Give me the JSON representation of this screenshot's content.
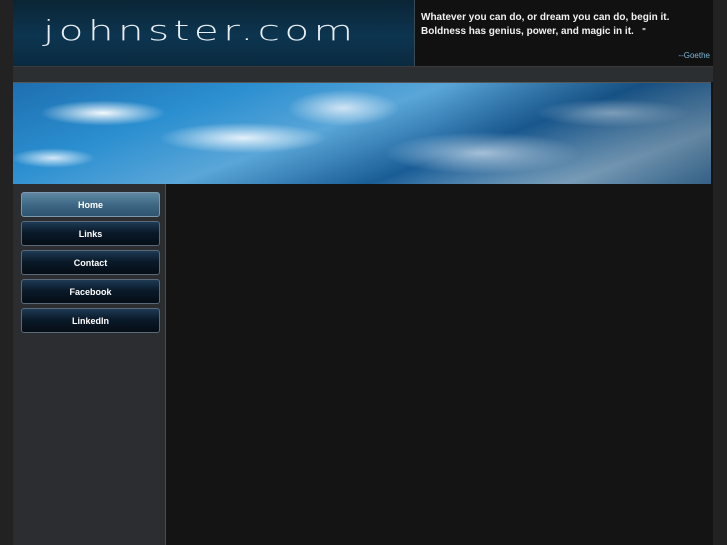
{
  "site": {
    "logo_text": "johnster.com"
  },
  "quote": {
    "text": "Whatever you can do, or dream you can do, begin it. Boldness has genius, power, and magic in it.",
    "mark": "\"",
    "author": "--Goethe"
  },
  "nav": {
    "items": [
      {
        "label": "Home",
        "active": true
      },
      {
        "label": "Links",
        "active": false
      },
      {
        "label": "Contact",
        "active": false
      },
      {
        "label": "Facebook",
        "active": false
      },
      {
        "label": "LinkedIn",
        "active": false
      }
    ]
  },
  "colors": {
    "accent": "#7ab6d8",
    "nav_active": "#3e6885",
    "nav_inactive": "#0a1a2a"
  }
}
